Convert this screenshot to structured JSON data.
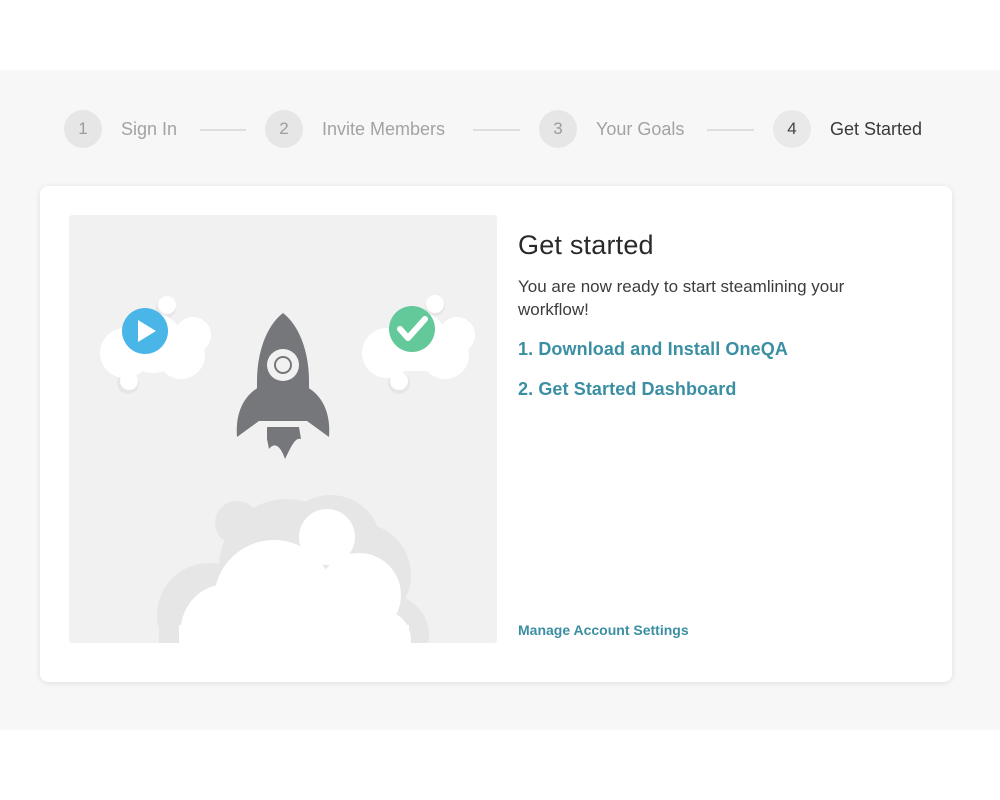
{
  "steps": [
    {
      "number": "1",
      "label": "Sign In",
      "active": false
    },
    {
      "number": "2",
      "label": "Invite Members",
      "active": false
    },
    {
      "number": "3",
      "label": "Your Goals",
      "active": false
    },
    {
      "number": "4",
      "label": "Get Started",
      "active": true
    }
  ],
  "card": {
    "title": "Get started",
    "subtitle": "You are now ready to start steamlining your workflow!",
    "links": [
      {
        "label": "1. Download and Install OneQA"
      },
      {
        "label": "2. Get Started Dashboard"
      }
    ],
    "manage_link": "Manage Account Settings"
  },
  "illustration": {
    "icons": [
      "rocket-icon",
      "play-icon",
      "checkmark-icon",
      "cloud-icon"
    ]
  },
  "colors": {
    "link": "#3b8fa3",
    "play_icon": "#4ab6e8",
    "check_icon": "#63c99a",
    "rocket": "#76777a",
    "page_band": "#f7f7f7"
  }
}
